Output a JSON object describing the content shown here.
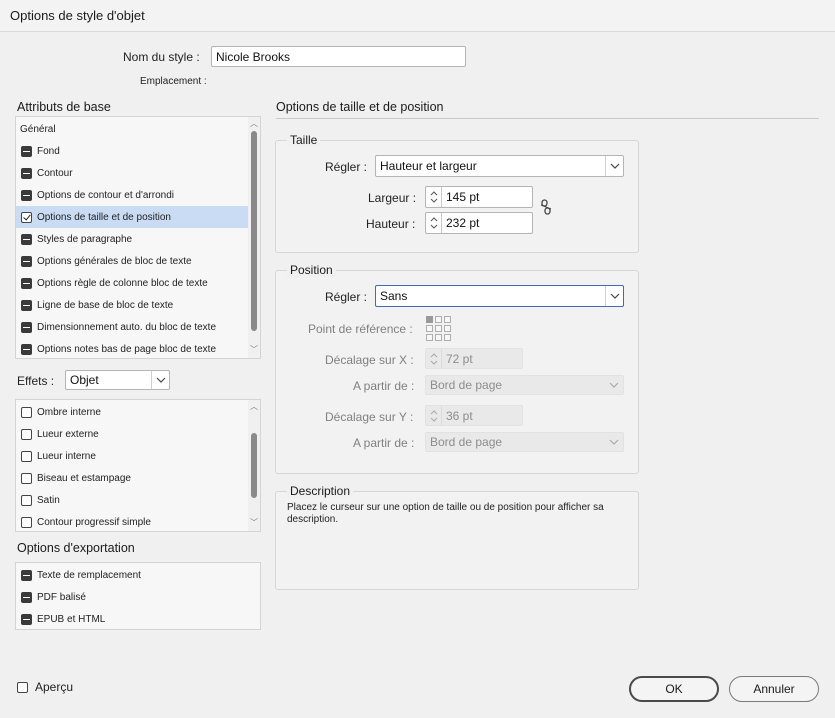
{
  "window": {
    "title": "Options de style d'objet"
  },
  "header": {
    "style_name_label": "Nom du style :",
    "style_name_value": "Nicole Brooks",
    "location_label": "Emplacement :"
  },
  "basic_attributes": {
    "title": "Attributs de base",
    "items": [
      {
        "label": "Général",
        "state": "none"
      },
      {
        "label": "Fond",
        "state": "mixed"
      },
      {
        "label": "Contour",
        "state": "mixed"
      },
      {
        "label": "Options de contour et d'arrondi",
        "state": "mixed"
      },
      {
        "label": "Options de taille et de position",
        "state": "checked"
      },
      {
        "label": "Styles de paragraphe",
        "state": "mixed"
      },
      {
        "label": "Options générales de bloc de texte",
        "state": "mixed"
      },
      {
        "label": "Options règle de colonne bloc de texte",
        "state": "mixed"
      },
      {
        "label": "Ligne de base de bloc de texte",
        "state": "mixed"
      },
      {
        "label": "Dimensionnement auto. du bloc de texte",
        "state": "mixed"
      },
      {
        "label": "Options notes bas de page bloc de texte",
        "state": "mixed"
      }
    ]
  },
  "effects": {
    "label": "Effets :",
    "selected": "Objet",
    "items": [
      {
        "label": "Ombre interne"
      },
      {
        "label": "Lueur externe"
      },
      {
        "label": "Lueur interne"
      },
      {
        "label": "Biseau et estampage"
      },
      {
        "label": "Satin"
      },
      {
        "label": "Contour progressif simple"
      }
    ]
  },
  "export_options": {
    "title": "Options d'exportation",
    "items": [
      {
        "label": "Texte de remplacement"
      },
      {
        "label": "PDF balisé"
      },
      {
        "label": "EPUB et HTML"
      }
    ]
  },
  "panel": {
    "title": "Options de taille et de position",
    "size": {
      "title": "Taille",
      "adjust_label": "Régler :",
      "adjust_value": "Hauteur et largeur",
      "width_label": "Largeur :",
      "width_value": "145 pt",
      "height_label": "Hauteur :",
      "height_value": "232 pt"
    },
    "position": {
      "title": "Position",
      "adjust_label": "Régler :",
      "adjust_value": "Sans",
      "reference_label": "Point de référence :",
      "offset_x_label": "Décalage sur X :",
      "offset_x_value": "72 pt",
      "from_x_label": "A partir de :",
      "from_x_value": "Bord de page",
      "offset_y_label": "Décalage sur Y :",
      "offset_y_value": "36 pt",
      "from_y_label": "A partir de :",
      "from_y_value": "Bord de page"
    },
    "description": {
      "title": "Description",
      "text": "Placez le curseur sur une option de taille ou de position pour afficher sa description."
    }
  },
  "footer": {
    "preview_label": "Aperçu",
    "ok_label": "OK",
    "cancel_label": "Annuler"
  },
  "colors": {
    "selection": "#c9dcf3",
    "focus_border": "#3b6fb6",
    "background": "#f0f0f0"
  }
}
